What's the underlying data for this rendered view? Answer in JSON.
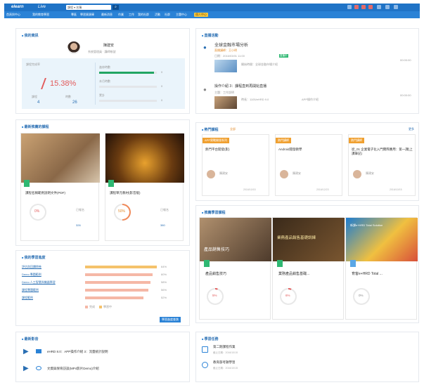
{
  "header": {
    "logo": "elearn",
    "logo_sub": "Live",
    "search_value": "課程 ▾ 名稱",
    "search_icon": "magnifier-icon",
    "nav": [
      "首頁與中心",
      "我的教育學習",
      "專區",
      "學習資源庫",
      "最新消息",
      "作業",
      "工作",
      "我的社群",
      "活動",
      "社群",
      "主題中心",
      "個人中心"
    ]
  },
  "profile": {
    "title": "我的資訊",
    "name": "陳建安",
    "role": "系統管理員 · 講師帳號",
    "completion_label": "課程完成率",
    "completion_value": "15.38%",
    "completion_fraction": 0.1538,
    "left_stat_label": "課程",
    "left_stat_value": "4",
    "right_stat_label": "時數",
    "right_stat_value": "26",
    "side_items": [
      {
        "label": "進修時數",
        "value": "0",
        "fill": 0.95
      },
      {
        "label": "本月時數",
        "value": "0",
        "fill": 0
      },
      {
        "label": "累計",
        "value": "0",
        "fill": 0
      }
    ]
  },
  "live": {
    "title": "直播活動",
    "items": [
      {
        "title": "全球金融市場分析",
        "subtitle": "直播講師：王小明",
        "meta": "日期：2016/03/01 11:00",
        "badge": "直播中",
        "desc": "開始時間：全球金融市場介紹",
        "time": "00:00:00"
      },
      {
        "title": "操作介紹 3：課程直到再開始直播",
        "subtitle": "主題：工作說明",
        "meta": "時長：1105/eHRD 9.0",
        "badge": "",
        "desc": "APP操作介紹",
        "time": "00:00:00"
      }
    ]
  },
  "courses": {
    "title": "最新推薦的課程",
    "items": [
      {
        "title": "課程名稱範例說明文件(PDF)",
        "percent": "0%",
        "percent_fraction": 0,
        "status": "已報名",
        "count": "326"
      },
      {
        "title": "課程單元教材(影音版)",
        "percent": "50%",
        "percent_fraction": 0.5,
        "status": "已報名",
        "count": "380"
      }
    ]
  },
  "hot": {
    "title": "熱門課程",
    "filter": "全部",
    "more": "更多",
    "items": [
      {
        "tag": "APP實戰開發系列",
        "title": "熱門平台開發(影)",
        "author": "陳建安",
        "date": "2016/10/15"
      },
      {
        "tag": "熱門講師",
        "title": "Android開發教學",
        "author": "陳建安",
        "date": "2016/12/23"
      },
      {
        "tag": "熱門講師",
        "title": "從_01 企業電子化入門實際應用：第一課(上課筆記)",
        "author": "陳建安",
        "date": "2016/10/15"
      }
    ]
  },
  "recommend": {
    "title": "推薦學習課程",
    "items": [
      {
        "banner": "產品銷售技巧",
        "title": "產品銷售技巧",
        "pct": "5%"
      },
      {
        "banner": "業務產品銷售基礎訓練",
        "title": "業務產品銷售基礎...",
        "pct": "6%"
      },
      {
        "banner": "新課e+HRD Total Solution",
        "title": "育客e+HRD Total ...",
        "pct": "0%"
      }
    ]
  },
  "progress": {
    "title": "我的學習進度",
    "items": [
      {
        "label": "評估與回饋問卷",
        "value": "64%",
        "fraction": 0.64,
        "color": "#f5c26b"
      },
      {
        "label": "Demo 專題範例",
        "value": "60%",
        "fraction": 0.6,
        "color": "#f5b8a6"
      },
      {
        "label": "Demo 人工智慧與機器學習",
        "value": "58%",
        "fraction": 0.58,
        "color": "#f5b8a6"
      },
      {
        "label": "課程專題範例",
        "value": "56%",
        "fraction": 0.56,
        "color": "#f5b8a6"
      },
      {
        "label": "課程範例",
        "value": "52%",
        "fraction": 0.52,
        "color": "#f5b8a6"
      }
    ],
    "legend_a": "完成",
    "legend_b": "學習中",
    "button": "學習進度查詢"
  },
  "videos": {
    "title": "最新影音",
    "items": [
      {
        "title": "eHRD 8.0：APP操作介紹 3：流量統計說明"
      },
      {
        "title": "文資與保育訪談(MP4影片Demo)介紹"
      }
    ]
  },
  "tasks": {
    "title": "學習任務",
    "items": [
      {
        "title": "第二期課程作業",
        "meta": "截止日期：2016/10/15"
      },
      {
        "title": "教育部考題學習",
        "meta": "截止日期：2016/10/15"
      }
    ]
  }
}
